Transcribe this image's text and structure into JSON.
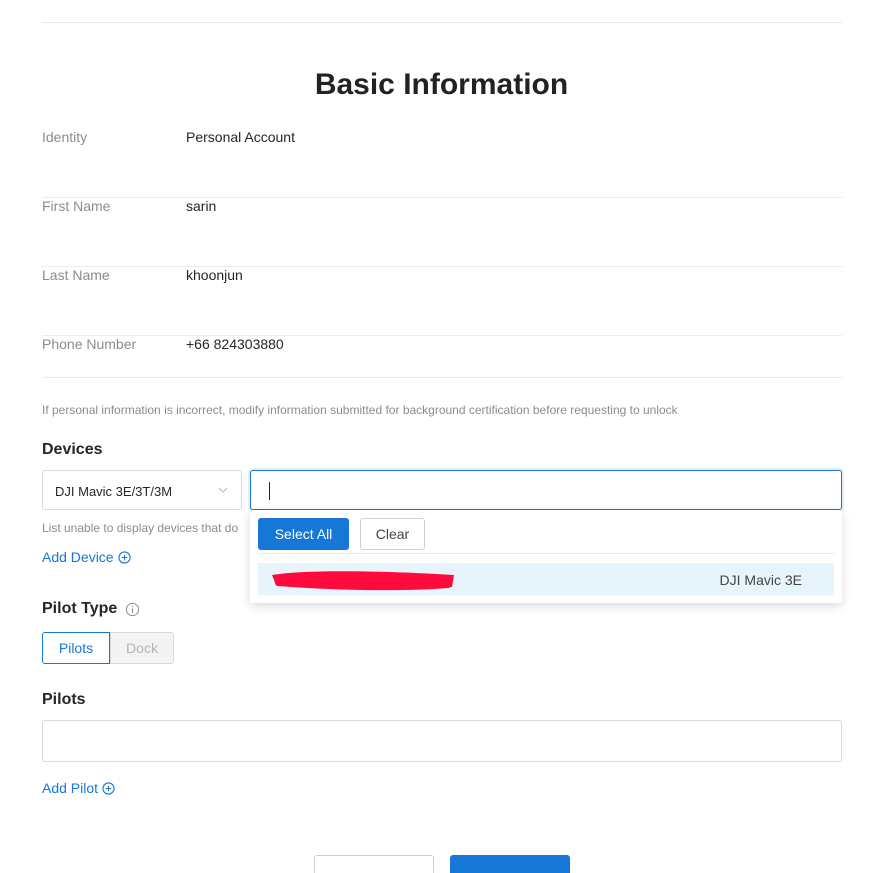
{
  "page": {
    "title": "Basic Information"
  },
  "basic_info": [
    {
      "label": "Identity",
      "value": "Personal Account"
    },
    {
      "label": "First Name",
      "value": "sarin"
    },
    {
      "label": "Last Name",
      "value": "khoonjun"
    },
    {
      "label": "Phone Number",
      "value": "+66 824303880"
    }
  ],
  "note": "If personal information is incorrect, modify information submitted for background certification before requesting to unlock",
  "devices": {
    "section_title": "Devices",
    "model_select_value": "DJI Mavic 3E/3T/3M",
    "search_value": "",
    "hint": "List unable to display devices that do",
    "add_label": "Add Device",
    "dropdown": {
      "select_all_label": "Select All",
      "clear_label": "Clear",
      "options": [
        {
          "model": "DJI Mavic 3E"
        }
      ]
    }
  },
  "pilot_type": {
    "section_title": "Pilot Type",
    "options": [
      "Pilots",
      "Dock"
    ],
    "selected": "Pilots"
  },
  "pilots": {
    "section_title": "Pilots",
    "add_label": "Add Pilot"
  },
  "colors": {
    "primary": "#1677d6",
    "redaction": "#ff0a3c",
    "option_highlight": "#e8f4fc"
  }
}
